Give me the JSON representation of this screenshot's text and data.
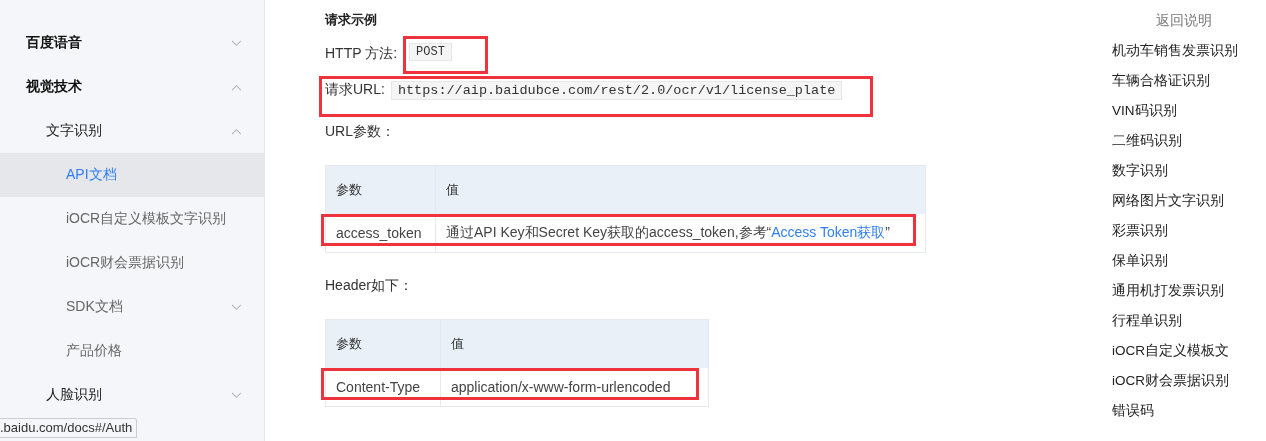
{
  "sidebar": {
    "items": [
      {
        "label": "百度语音",
        "expanded": false,
        "selected": false
      },
      {
        "label": "视觉技术",
        "expanded": true,
        "selected": false,
        "children": [
          {
            "label": "文字识别",
            "expanded": true,
            "selected": false,
            "children": [
              {
                "label": "API文档",
                "selected": true
              },
              {
                "label": "iOCR自定义模板文字识别",
                "selected": false
              },
              {
                "label": "iOCR财会票据识别",
                "selected": false
              },
              {
                "label": "SDK文档",
                "expanded": false,
                "selected": false
              },
              {
                "label": "产品价格",
                "selected": false
              }
            ]
          },
          {
            "label": "人脸识别",
            "expanded": false,
            "selected": false
          }
        ]
      }
    ]
  },
  "status_url": ".baidu.com/docs#/Auth",
  "content": {
    "heading": "请求示例",
    "method": {
      "label": "HTTP 方法:",
      "value": "POST",
      "highlighted": true
    },
    "url": {
      "label": "请求URL:",
      "value": "https://aip.baidubce.com/rest/2.0/ocr/v1/license_plate",
      "highlighted": true
    },
    "tables": [
      {
        "title": "URL参数：",
        "columns": [
          "参数",
          "值"
        ],
        "rows": [
          {
            "param": "access_token",
            "value": "通过API Key和Secret Key获取的access_token,参考",
            "quote_open": "“",
            "link": "Access Token获取",
            "quote_close": "”",
            "highlighted": true
          }
        ]
      },
      {
        "title": "Header如下：",
        "columns": [
          "参数",
          "值"
        ],
        "rows": [
          {
            "param": "Content-Type",
            "value": "application/x-www-form-urlencoded",
            "highlighted": true
          }
        ]
      }
    ]
  },
  "toc": {
    "items": [
      {
        "label": "返回说明",
        "kind": "sub"
      },
      {
        "label": "机动车销售发票识别",
        "kind": "item"
      },
      {
        "label": "车辆合格证识别",
        "kind": "item"
      },
      {
        "label": "VIN码识别",
        "kind": "item"
      },
      {
        "label": "二维码识别",
        "kind": "item"
      },
      {
        "label": "数字识别",
        "kind": "item"
      },
      {
        "label": "网络图片文字识别",
        "kind": "item"
      },
      {
        "label": "彩票识别",
        "kind": "item"
      },
      {
        "label": "保单识别",
        "kind": "item"
      },
      {
        "label": "通用机打发票识别",
        "kind": "item"
      },
      {
        "label": "行程单识别",
        "kind": "item"
      },
      {
        "label": "iOCR自定义模板文",
        "kind": "item"
      },
      {
        "label": "iOCR财会票据识别",
        "kind": "item"
      },
      {
        "label": "错误码",
        "kind": "item"
      }
    ]
  }
}
